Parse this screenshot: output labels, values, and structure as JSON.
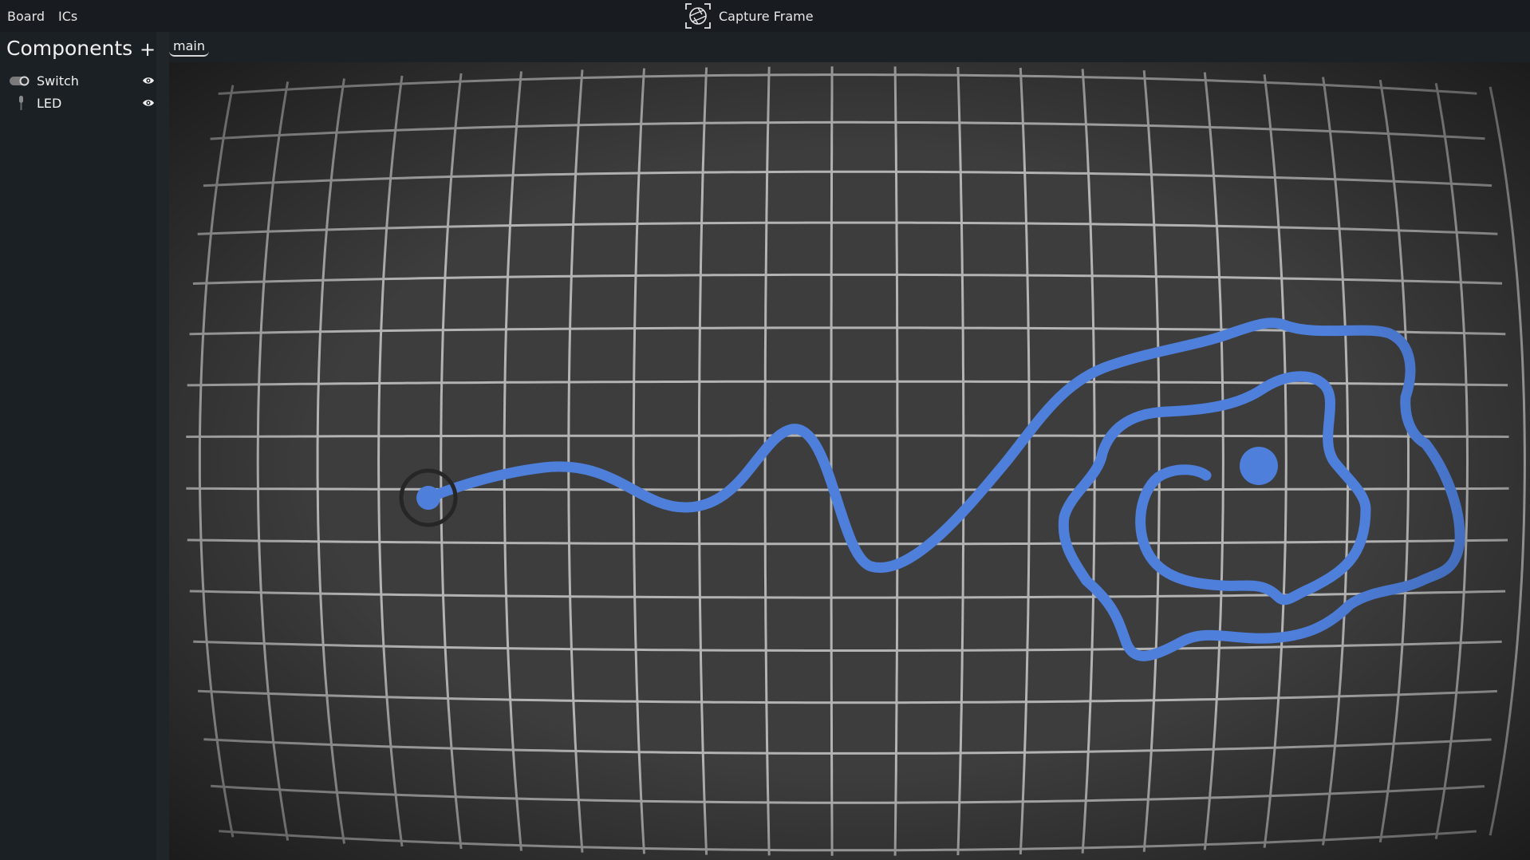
{
  "menubar": {
    "items": [
      "Board",
      "ICs"
    ],
    "capture_label": "Capture Frame",
    "capture_icon": "camera-aperture-icon"
  },
  "sidebar": {
    "title": "Components",
    "add_label": "+",
    "items": [
      {
        "label": "Switch",
        "icon": "toggle-switch-icon",
        "visible_icon": "eye-icon"
      },
      {
        "label": "LED",
        "icon": "led-icon",
        "visible_icon": "eye-icon"
      }
    ]
  },
  "tabs": [
    {
      "label": "main",
      "active": true
    }
  ],
  "canvas": {
    "wire_color": "#4e7fdb",
    "grid_color": "#c8c8c8",
    "background": "#3d3d3d"
  },
  "colors": {
    "accent": "#4e7fdb",
    "panel": "#1b2025",
    "menubar": "#181c21"
  }
}
